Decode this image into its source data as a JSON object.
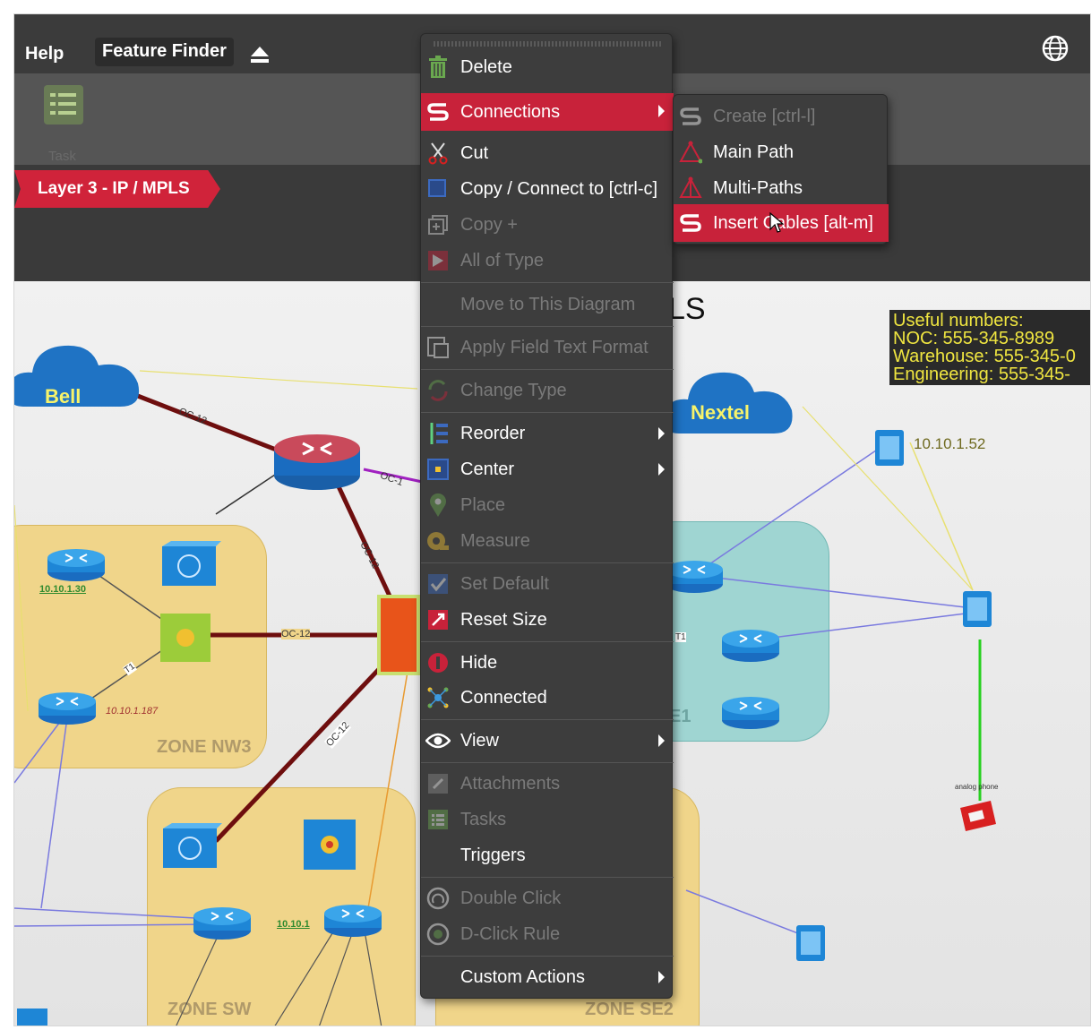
{
  "topbar": {
    "help_label": "Help",
    "feature_finder_label": "Feature Finder",
    "eject_icon": "eject-icon",
    "globe_icon": "globe-icon"
  },
  "toolbar": {
    "task_label": "Task"
  },
  "layer": {
    "name": "Layer 3 - IP / MPLS"
  },
  "diagram": {
    "title_fragment": "LS",
    "useful_numbers": [
      "Useful numbers:",
      "NOC: 555-345-8989",
      "Warehouse: 555-345-0",
      "Engineering: 555-345-"
    ],
    "clouds": {
      "left": "Bell",
      "right": "Nextel"
    },
    "zones": {
      "nw3": "ZONE NW3",
      "sw": "ZONE SW",
      "se2": "ZONE SE2",
      "e1": "E1"
    },
    "links": {
      "oc12_a": "OC-12",
      "oc12_b": "OC-12",
      "oc12_c": "OC-12",
      "oc_d": "OC-1",
      "oc_e": "OC-12",
      "t1": "T1",
      "t1b": "T1"
    },
    "ips": {
      "nw_router_ip": "10.10.1.30",
      "nw_dev_ip": "10.10.1.187",
      "sw_dev_ip": "10.10.1",
      "nextel_phone_ip": "10.10.1.52"
    },
    "phone_label": "analog phone"
  },
  "context_menu": {
    "items": [
      {
        "label": "Delete",
        "icon": "trash-icon"
      },
      {
        "label": "Connections",
        "icon": "connections-icon"
      },
      {
        "label": "Cut",
        "icon": "scissors-icon"
      },
      {
        "label": "Copy / Connect to [ctrl-c]",
        "icon": "copy-icon"
      },
      {
        "label": "Copy +",
        "icon": "copy-plus-icon"
      },
      {
        "label": "All of Type",
        "icon": "all-of-type-icon"
      },
      {
        "label": "Move to This Diagram",
        "icon": ""
      },
      {
        "label": "Apply Field Text Format",
        "icon": "format-icon"
      },
      {
        "label": "Change Type",
        "icon": "change-type-icon"
      },
      {
        "label": "Reorder",
        "icon": "reorder-icon"
      },
      {
        "label": "Center",
        "icon": "center-icon"
      },
      {
        "label": "Place",
        "icon": "place-icon"
      },
      {
        "label": "Measure",
        "icon": "measure-icon"
      },
      {
        "label": "Set Default",
        "icon": "set-default-icon"
      },
      {
        "label": "Reset Size",
        "icon": "reset-size-icon"
      },
      {
        "label": "Hide",
        "icon": "hide-icon"
      },
      {
        "label": "Connected",
        "icon": "connected-icon"
      },
      {
        "label": "View",
        "icon": "eye-icon"
      },
      {
        "label": "Attachments",
        "icon": "attachment-icon"
      },
      {
        "label": "Tasks",
        "icon": "tasks-icon"
      },
      {
        "label": "Triggers",
        "icon": ""
      },
      {
        "label": "Double Click",
        "icon": "double-click-icon"
      },
      {
        "label": "D-Click Rule",
        "icon": "d-click-rule-icon"
      },
      {
        "label": "Custom Actions",
        "icon": ""
      }
    ]
  },
  "submenu": {
    "items": [
      {
        "label": "Create [ctrl-l]",
        "icon": "connections-icon"
      },
      {
        "label": "Main Path",
        "icon": "main-path-icon"
      },
      {
        "label": "Multi-Paths",
        "icon": "multi-paths-icon"
      },
      {
        "label": "Insert Cables [alt-m]",
        "icon": "insert-cables-icon"
      }
    ]
  },
  "colors": {
    "menu_bg": "#3d3d3d",
    "highlight": "#c8223a",
    "zone_yellow": "#f0d58a",
    "zone_teal": "#9fd5d2",
    "cloud_blue": "#1f73c4"
  }
}
